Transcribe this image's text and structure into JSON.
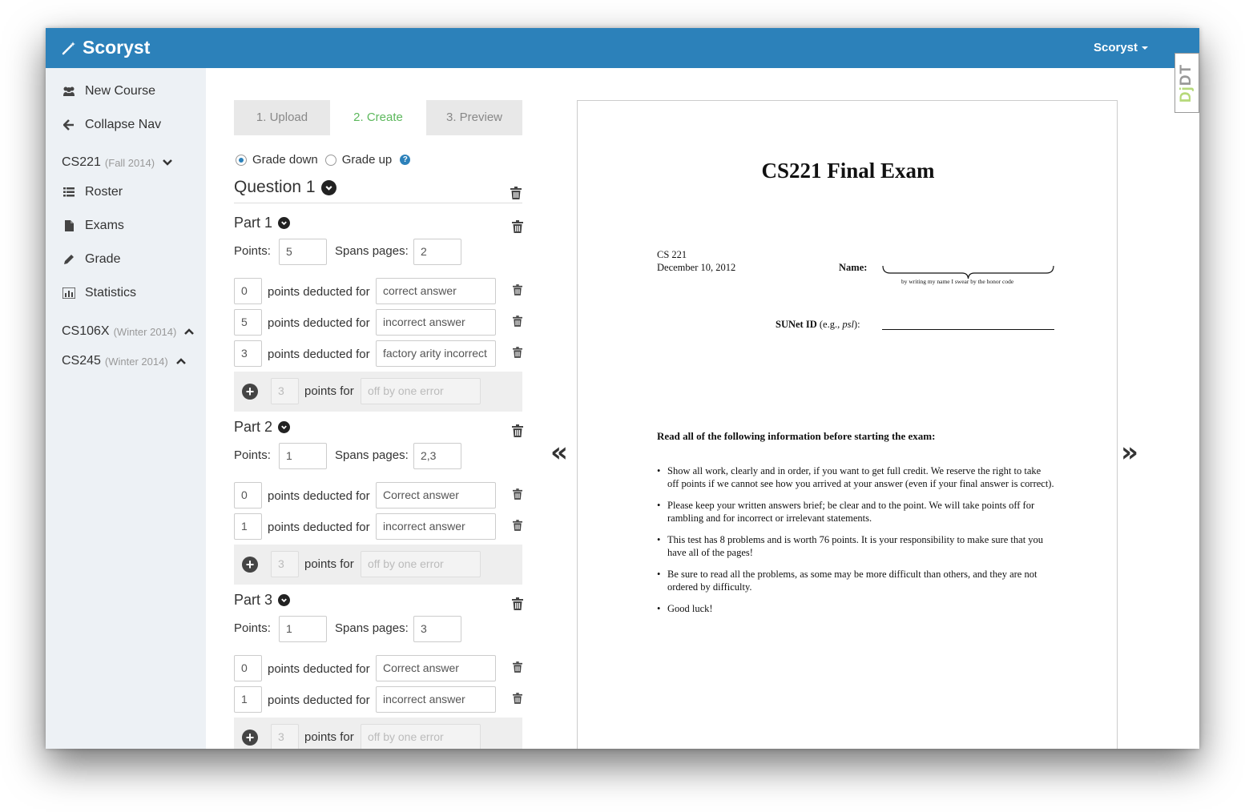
{
  "app": {
    "brand": "Scoryst",
    "user_menu": "Scoryst",
    "dev_tab": "DjDT"
  },
  "sidebar": {
    "items": [
      {
        "label": "New Course",
        "icon": "users-icon"
      },
      {
        "label": "Collapse Nav",
        "icon": "arrow-left-icon"
      }
    ],
    "courses": [
      {
        "name": "CS221",
        "term": "(Fall 2014)",
        "expanded": true,
        "items": [
          {
            "label": "Roster",
            "icon": "list-icon"
          },
          {
            "label": "Exams",
            "icon": "file-icon"
          },
          {
            "label": "Grade",
            "icon": "pencil-icon"
          },
          {
            "label": "Statistics",
            "icon": "bar-chart-icon"
          }
        ]
      },
      {
        "name": "CS106X",
        "term": "(Winter 2014)",
        "expanded": false
      },
      {
        "name": "CS245",
        "term": "(Winter 2014)",
        "expanded": false
      }
    ]
  },
  "steps": {
    "upload": "1. Upload",
    "create": "2. Create",
    "preview": "3. Preview"
  },
  "grading": {
    "down": "Grade down",
    "up": "Grade up",
    "help": "?"
  },
  "labels": {
    "points": "Points:",
    "spans": "Spans pages:",
    "deducted": "points deducted for",
    "points_for": "points for"
  },
  "question": {
    "title": "Question 1",
    "parts": [
      {
        "title": "Part 1",
        "points": "5",
        "pages": "2",
        "rubrics": [
          {
            "points": "0",
            "desc": "correct answer"
          },
          {
            "points": "5",
            "desc": "incorrect answer"
          },
          {
            "points": "3",
            "desc": "factory arity incorrect"
          }
        ],
        "new_points_placeholder": "3",
        "new_desc_placeholder": "off by one error"
      },
      {
        "title": "Part 2",
        "points": "1",
        "pages": "2,3",
        "rubrics": [
          {
            "points": "0",
            "desc": "Correct answer"
          },
          {
            "points": "1",
            "desc": "incorrect answer"
          }
        ],
        "new_points_placeholder": "3",
        "new_desc_placeholder": "off by one error"
      },
      {
        "title": "Part 3",
        "points": "1",
        "pages": "3",
        "rubrics": [
          {
            "points": "0",
            "desc": "Correct answer"
          },
          {
            "points": "1",
            "desc": "incorrect answer"
          }
        ],
        "new_points_placeholder": "3",
        "new_desc_placeholder": "off by one error"
      }
    ]
  },
  "nav": {
    "prev": "«",
    "next": "»"
  },
  "exam": {
    "title": "CS221 Final Exam",
    "course": "CS 221",
    "date": "December 10, 2012",
    "name_label": "Name:",
    "honor": "by writing my name I swear by the honor code",
    "sunet_label": "SUNet ID",
    "sunet_hint": "(e.g., psl):",
    "instructions_heading": "Read all of the following information before starting the exam:",
    "bullets": [
      "Show all work, clearly and in order, if you want to get full credit. We reserve the right to take off points if we cannot see how you arrived at your answer (even if your final answer is correct).",
      "Please keep your written answers brief; be clear and to the point. We will take points off for rambling and for incorrect or irrelevant statements.",
      "This test has 8 problems and is worth 76 points. It is your responsibility to make sure that you have all of the pages!",
      "Be sure to read all the problems, as some may be more difficult than others, and they are not ordered by difficulty.",
      "Good luck!"
    ]
  }
}
